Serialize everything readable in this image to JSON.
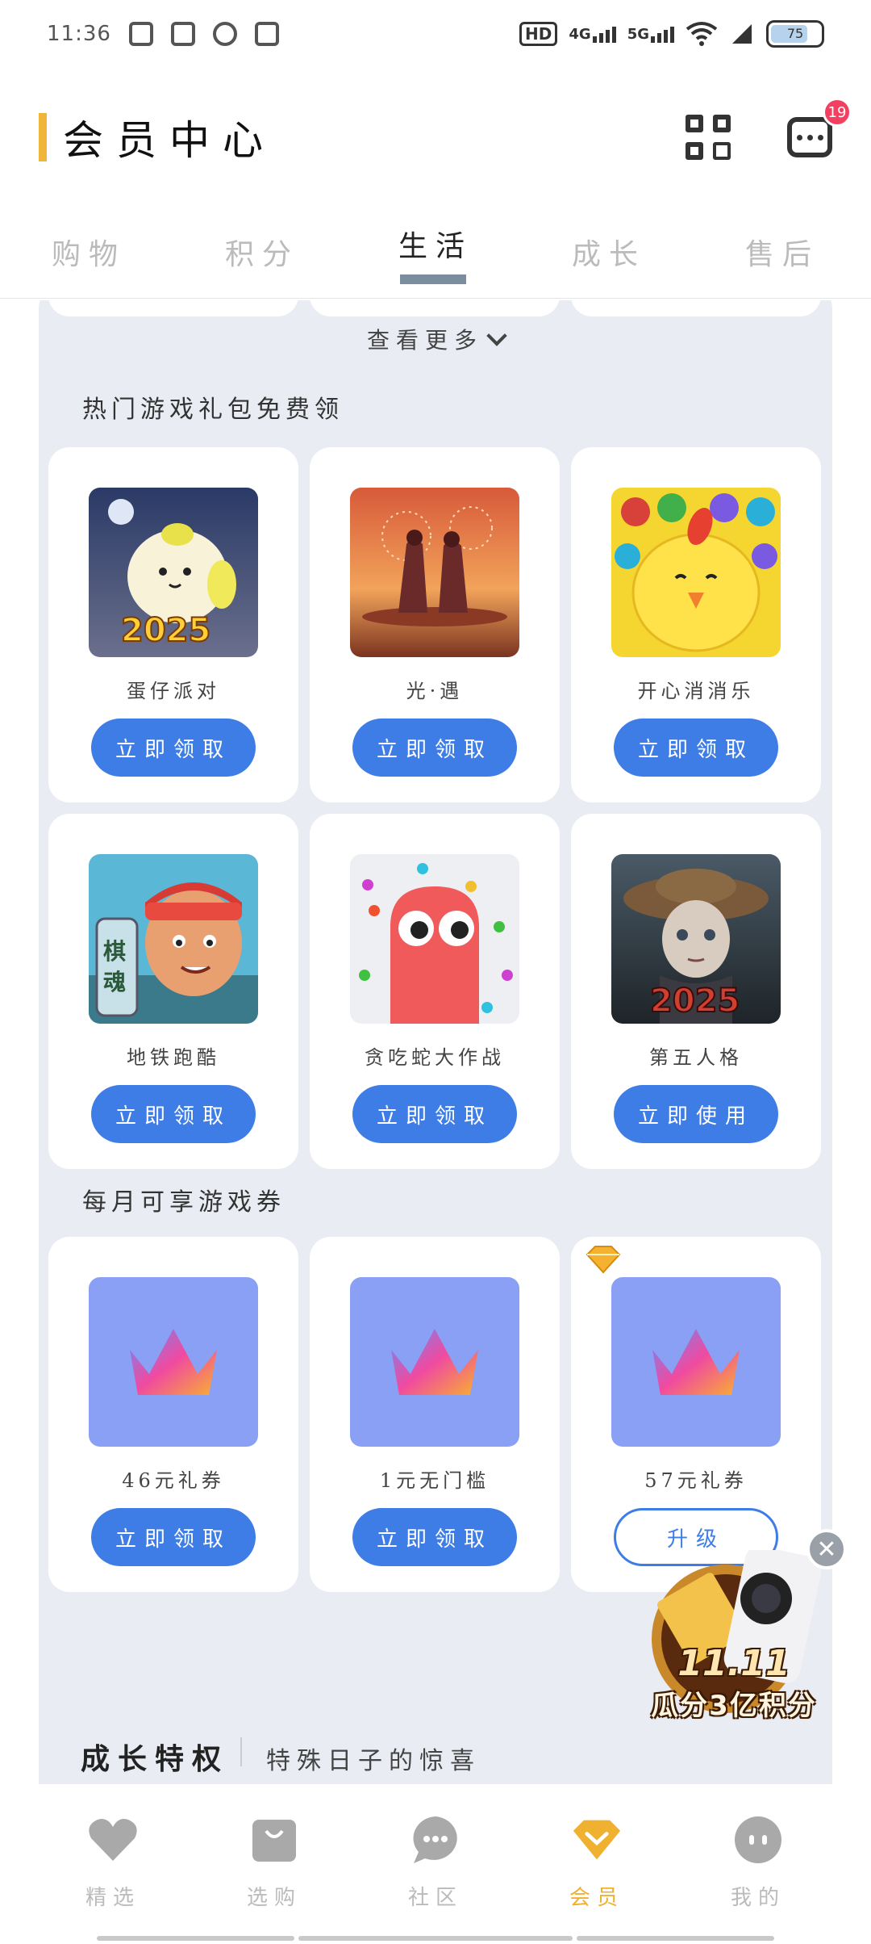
{
  "status_bar": {
    "time": "11:36",
    "hd": "HD",
    "sim1": "4G",
    "sim2": "5G",
    "battery": "75"
  },
  "header": {
    "title": "会员中心",
    "message_badge": "19",
    "accent_color": "#f0b63a"
  },
  "tabs": [
    {
      "label": "购物",
      "active": false
    },
    {
      "label": "积分",
      "active": false
    },
    {
      "label": "生活",
      "active": true
    },
    {
      "label": "成长",
      "active": false
    },
    {
      "label": "售后",
      "active": false
    }
  ],
  "see_more": "查看更多",
  "hot_games": {
    "title": "热门游戏礼包免费领",
    "items": [
      {
        "name": "蛋仔派对",
        "button": "立即领取",
        "icon": "eggy-party-icon"
      },
      {
        "name": "光·遇",
        "button": "立即领取",
        "icon": "sky-icon"
      },
      {
        "name": "开心消消乐",
        "button": "立即领取",
        "icon": "happy-elimination-icon"
      },
      {
        "name": "地铁跑酷",
        "button": "立即领取",
        "icon": "subway-surfers-icon"
      },
      {
        "name": "贪吃蛇大作战",
        "button": "立即领取",
        "icon": "snake-icon"
      },
      {
        "name": "第五人格",
        "button": "立即使用",
        "icon": "identity-v-icon"
      }
    ]
  },
  "monthly_coupons": {
    "title": "每月可享游戏券",
    "items": [
      {
        "name": "46元礼券",
        "button": "立即领取",
        "icon": "crown-icon"
      },
      {
        "name": "1元无门槛",
        "button": "立即领取",
        "icon": "crown-icon"
      },
      {
        "name": "57元礼券",
        "button": "升级",
        "icon": "crown-icon"
      }
    ]
  },
  "growth": {
    "title": "成长特权",
    "subtitle": "特殊日子的惊喜"
  },
  "promo": {
    "big": "11.11",
    "text": "瓜分3亿积分"
  },
  "bottom_nav": [
    {
      "label": "精选",
      "icon": "heart-icon",
      "active": false
    },
    {
      "label": "选购",
      "icon": "shopping-bag-icon",
      "active": false
    },
    {
      "label": "社区",
      "icon": "chat-bubble-icon",
      "active": false
    },
    {
      "label": "会员",
      "icon": "diamond-icon",
      "active": true
    },
    {
      "label": "我的",
      "icon": "profile-icon",
      "active": false
    }
  ],
  "colors": {
    "primary_button": "#3f7de6",
    "panel_bg": "#e9edf3",
    "active_nav": "#f0b030"
  }
}
